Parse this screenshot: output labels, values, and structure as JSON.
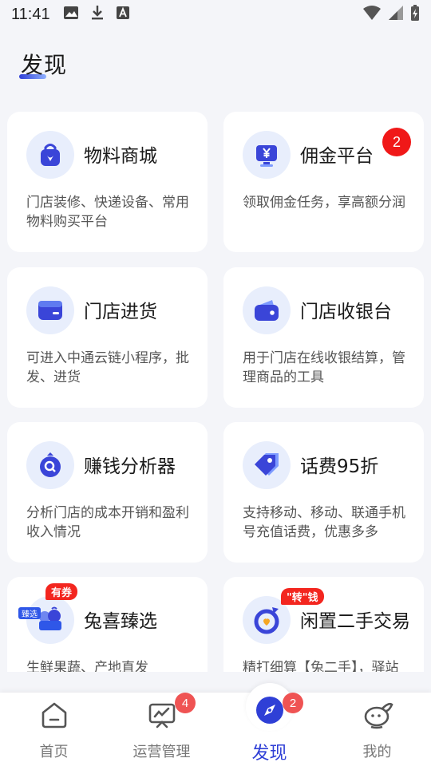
{
  "status_bar": {
    "time": "11:41",
    "left_icons": [
      "image-icon",
      "download-icon",
      "font-icon"
    ],
    "right_icons": [
      "wifi-icon",
      "signal-icon",
      "battery-icon"
    ]
  },
  "page": {
    "title": "发现"
  },
  "cards": [
    {
      "title": "物料商城",
      "desc": "门店装修、快递设备、常用物料购买平台",
      "icon": "shopping-bag-icon"
    },
    {
      "title": "佣金平台",
      "desc": "领取佣金任务，享高额分润",
      "icon": "yuan-screen-icon",
      "badge": "2"
    },
    {
      "title": "门店进货",
      "desc": "可进入中通云链小程序，批发、进货",
      "icon": "box-icon"
    },
    {
      "title": "门店收银台",
      "desc": "用于门店在线收银结算，管理商品的工具",
      "icon": "wallet-icon"
    },
    {
      "title": "赚钱分析器",
      "desc": "分析门店的成本开销和盈利收入情况",
      "icon": "analysis-icon"
    },
    {
      "title": "话费95折",
      "desc": "支持移动、移动、联通手机号充值话费，优惠多多",
      "icon": "tag-icon"
    },
    {
      "title": "兔喜臻选",
      "desc": "生鲜果蔬、产地直发",
      "icon": "fruit-basket-icon",
      "tag": "有券",
      "mini_tag": "臻选"
    },
    {
      "title": "闲置二手交易",
      "desc": "精打细算【兔二手】，驿站闲置轻松卖",
      "icon": "exchange-icon",
      "tag": "\"转\"钱"
    }
  ],
  "nav": {
    "items": [
      {
        "label": "首页",
        "icon": "home-icon"
      },
      {
        "label": "运营管理",
        "icon": "chart-board-icon",
        "badge": "4"
      },
      {
        "label": "发现",
        "icon": "compass-icon",
        "badge": "2",
        "active": true
      },
      {
        "label": "我的",
        "icon": "profile-icon"
      }
    ]
  },
  "colors": {
    "accent": "#2f3fd6",
    "badge_red": "#f01818",
    "nav_badge": "#ef5353",
    "background": "#f4f5f9",
    "icon_circle": "#e8eefc"
  }
}
